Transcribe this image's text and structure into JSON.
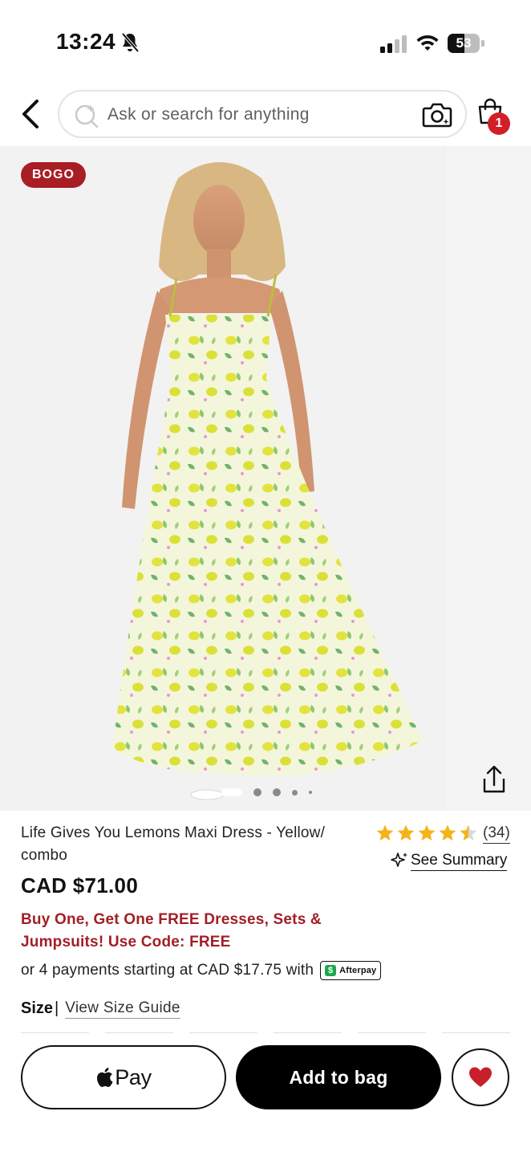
{
  "status_bar": {
    "time": "13:24",
    "battery_level": "53",
    "battery_fraction": 0.53
  },
  "header": {
    "search_placeholder": "Ask or search for anything",
    "cart_count": "1",
    "icons": [
      "back-chevron-icon",
      "sparkle-search-icon",
      "camera-icon",
      "shopping-bag-icon"
    ]
  },
  "gallery": {
    "badge": "BOGO",
    "image_count": 5,
    "active_index": 0
  },
  "product": {
    "title": "Life Gives You Lemons Maxi Dress - Yellow/ combo",
    "rating": 4.5,
    "rating_count": "(34)",
    "see_summary": "See Summary",
    "price": "CAD $71.00",
    "promo": "Buy One, Get One FREE Dresses, Sets & Jumpsuits! Use Code: FREE",
    "installments_text": "or 4 payments starting at CAD $17.75 with",
    "afterpay_label": "Afterpay",
    "size_label": "Size",
    "size_guide_link": "View Size Guide"
  },
  "actions": {
    "apple_pay_label": "Pay",
    "add_to_bag_label": "Add to bag"
  },
  "colors": {
    "accent_red": "#a91e24",
    "badge_red": "#d21f27",
    "star_yellow": "#f5b31a",
    "heart_red": "#c8202a"
  }
}
